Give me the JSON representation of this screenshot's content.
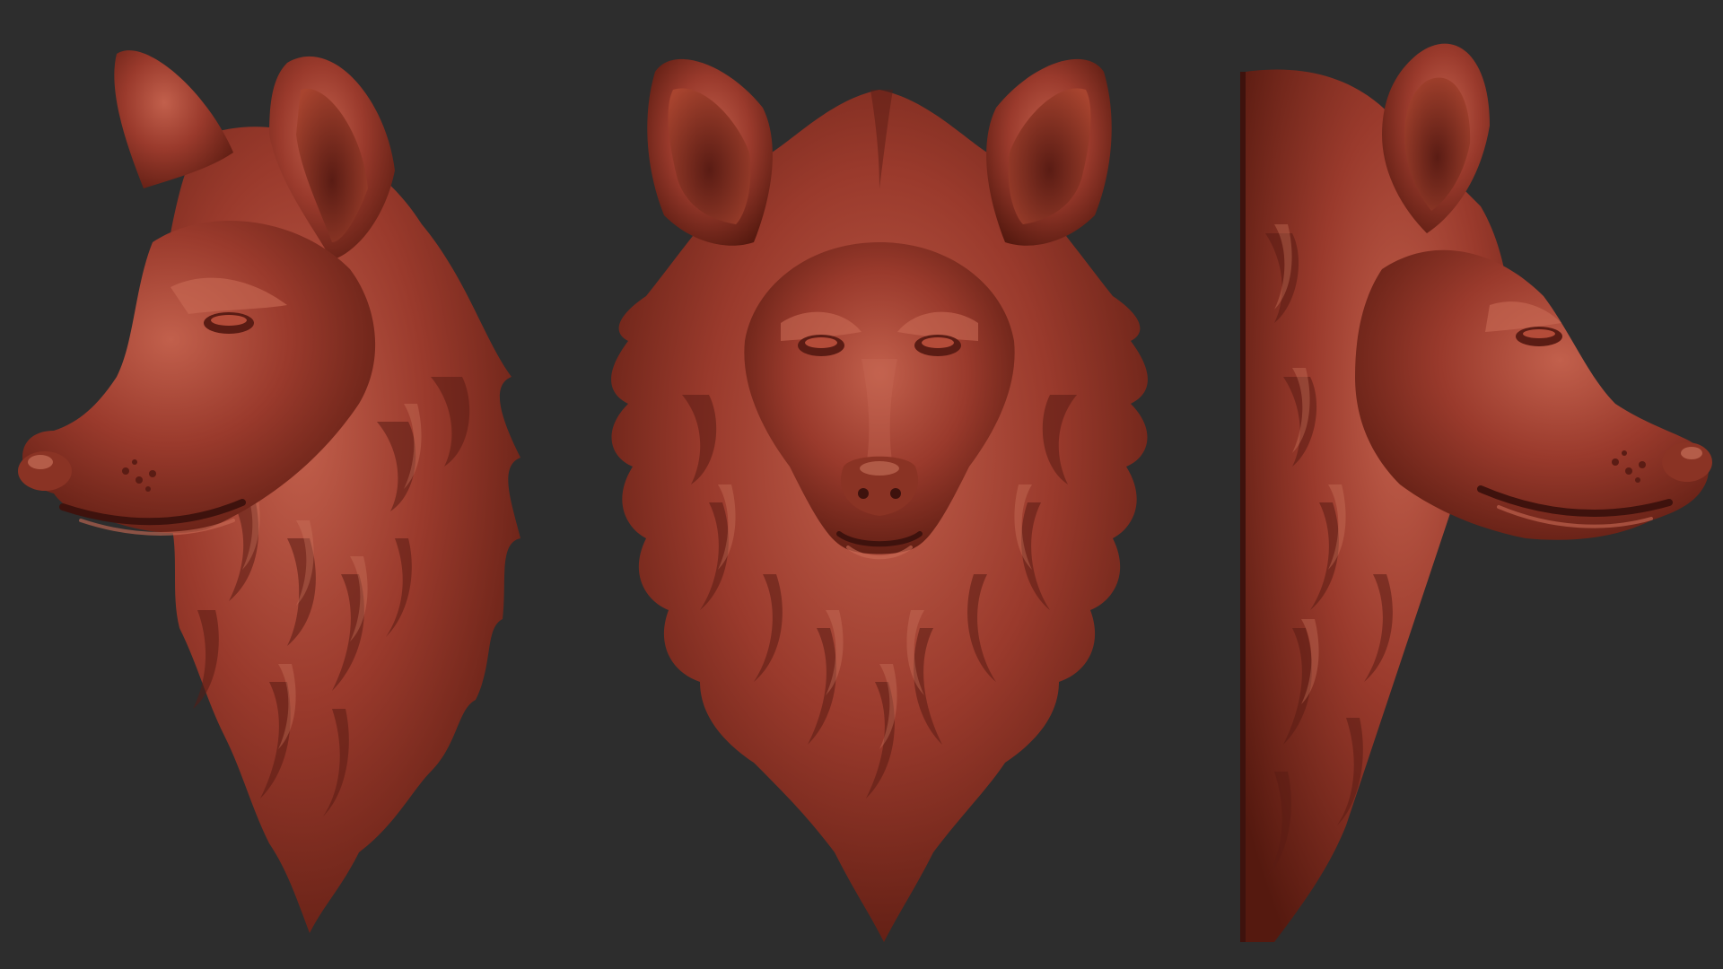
{
  "scene": {
    "background_color": "#2d2d2d",
    "material": {
      "base": "#9a3a2c",
      "shadow": "#5a1c14",
      "deep": "#3e120d",
      "highlight": "#c96a55",
      "specular": "#e39a84"
    },
    "views": [
      {
        "id": "left",
        "label": "",
        "orientation": "profile-facing-left"
      },
      {
        "id": "front",
        "label": "",
        "orientation": "front"
      },
      {
        "id": "right",
        "label": "",
        "orientation": "profile-facing-right"
      }
    ]
  }
}
